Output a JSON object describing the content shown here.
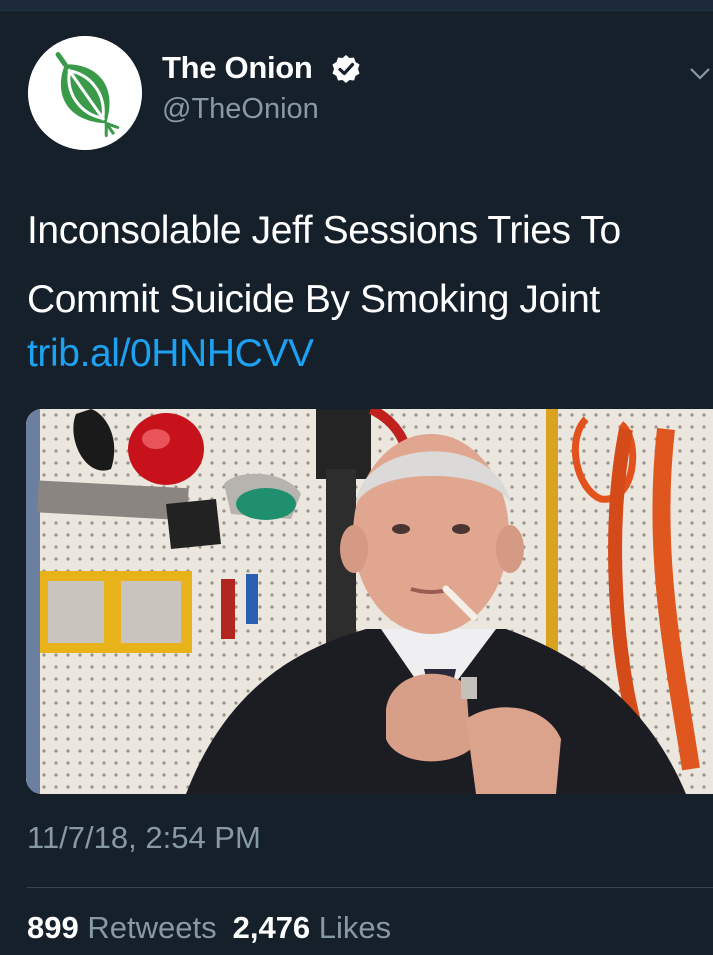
{
  "account": {
    "name": "The Onion",
    "handle": "@TheOnion",
    "verified": true,
    "avatar_icon": "onion-logo-icon",
    "brand_color": "#3a9a4a"
  },
  "tweet": {
    "headline": "Inconsolable Jeff Sessions Tries To Commit Suicide By Smoking Joint",
    "link": "trib.al/0HNHCVV",
    "timestamp": "11/7/18, 2:54 PM"
  },
  "stats": {
    "retweets_count": "899",
    "retweets_label": "Retweets",
    "likes_count": "2,476",
    "likes_label": "Likes"
  },
  "colors": {
    "background": "#15202b",
    "link": "#1da1f2",
    "secondary_text": "#8899a6"
  }
}
